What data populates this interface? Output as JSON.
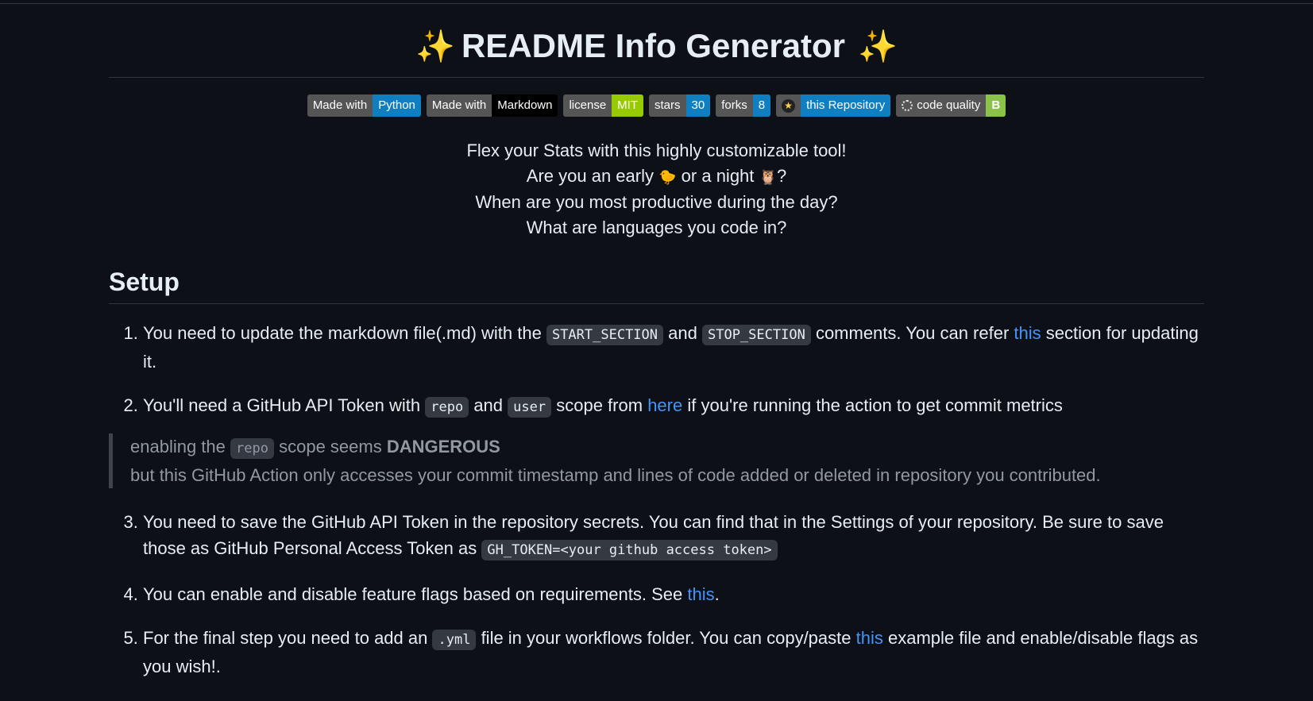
{
  "title": "README Info Generator",
  "badges": [
    {
      "key": "Made with",
      "value": "Python",
      "color": "#0f7fc1"
    },
    {
      "key": "Made with",
      "value": "Markdown",
      "color": "#000000"
    },
    {
      "key": "license",
      "value": "MIT",
      "color": "#97ca00"
    },
    {
      "key": "stars",
      "value": "30",
      "color": "#0f7fc1"
    },
    {
      "key": "forks",
      "value": "8",
      "color": "#0f7fc1"
    },
    {
      "key": "",
      "value": "this Repository",
      "color": "#0f7fc1",
      "icon": "star-icon"
    },
    {
      "key": "code quality",
      "value": "B",
      "color": "#8bc34a",
      "icon": "ring-icon"
    }
  ],
  "intro": {
    "line1": "Flex your Stats with this highly customizable tool!",
    "line2_a": "Are you an early",
    "line2_emoji1": "🐤",
    "line2_b": "or a night",
    "line2_emoji2": "🦉",
    "line2_c": "?",
    "line3": "When are you most productive during the day?",
    "line4": "What are languages you code in?"
  },
  "setup": {
    "heading": "Setup",
    "step1": {
      "t1": "You need to update the markdown file(.md) with the",
      "code1": "START_SECTION",
      "t2": "and",
      "code2": "STOP_SECTION",
      "t3": "comments. You can refer",
      "link": "this",
      "t4": "section for updating it."
    },
    "step2": {
      "t1": "You'll need a GitHub API Token with",
      "code1": "repo",
      "t2": "and",
      "code2": "user",
      "t3": "scope from",
      "link": "here",
      "t4": "if you're running the action to get commit metrics"
    },
    "quote": {
      "t1": "enabling the",
      "code": "repo",
      "t2": "scope seems",
      "strong": "DANGEROUS",
      "line2": "but this GitHub Action only accesses your commit timestamp and lines of code added or deleted in repository you contributed."
    },
    "step3": {
      "t1": "You need to save the GitHub API Token in the repository secrets. You can find that in the Settings of your repository. Be sure to save those as GitHub Personal Access Token as",
      "code": "GH_TOKEN=<your github access token>"
    },
    "step4": {
      "t1": "You can enable and disable feature flags based on requirements. See",
      "link": "this",
      "t2": "."
    },
    "step5": {
      "t1": "For the final step you need to add an",
      "code": ".yml",
      "t2": "file in your workflows folder. You can copy/paste",
      "link": "this",
      "t3": "example file and enable/disable flags as you wish!."
    }
  }
}
